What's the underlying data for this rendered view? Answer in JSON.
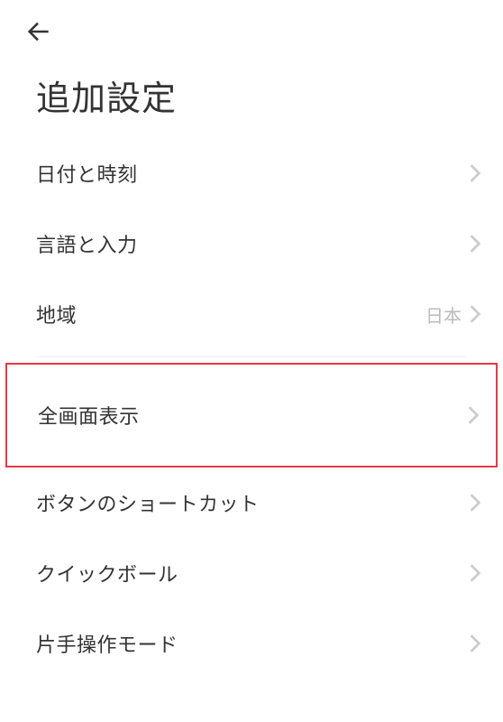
{
  "header": {
    "title": "追加設定"
  },
  "rows": {
    "datetime": {
      "label": "日付と時刻"
    },
    "language": {
      "label": "言語と入力"
    },
    "region": {
      "label": "地域",
      "value": "日本"
    },
    "fullscreen": {
      "label": "全画面表示"
    },
    "shortcut": {
      "label": "ボタンのショートカット"
    },
    "quickball": {
      "label": "クイックボール"
    },
    "onehanded": {
      "label": "片手操作モード"
    }
  },
  "highlight": "fullscreen"
}
